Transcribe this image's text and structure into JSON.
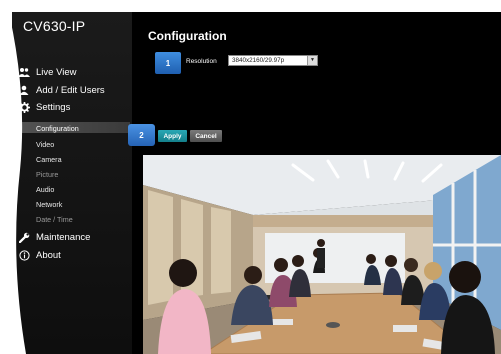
{
  "app": {
    "brand": "CV630-IP"
  },
  "sidebar": {
    "items": [
      {
        "label": "Live View",
        "icon": "users-icon"
      },
      {
        "label": "Add / Edit Users",
        "icon": "user-icon"
      },
      {
        "label": "Settings",
        "icon": "gear-icon"
      }
    ],
    "settings_subitems": [
      "Configuration",
      "Video",
      "Camera",
      "Picture",
      "Audio",
      "Network",
      "Date / Time"
    ],
    "bottom_items": [
      {
        "label": "Maintenance",
        "icon": "wrench-icon"
      },
      {
        "label": "About",
        "icon": "info-icon"
      }
    ],
    "active_subitem": "Configuration"
  },
  "main": {
    "title": "Configuration",
    "step1_label": "1",
    "resolution_label": "Resolution",
    "resolution_value": "3840x2160/29.97p",
    "step2_label": "2",
    "apply_label": "Apply",
    "cancel_label": "Cancel"
  },
  "colors": {
    "background": "#000000",
    "step_blue": "#2f78cf",
    "apply_teal": "#1a95a2",
    "cancel_gray": "#636363"
  }
}
